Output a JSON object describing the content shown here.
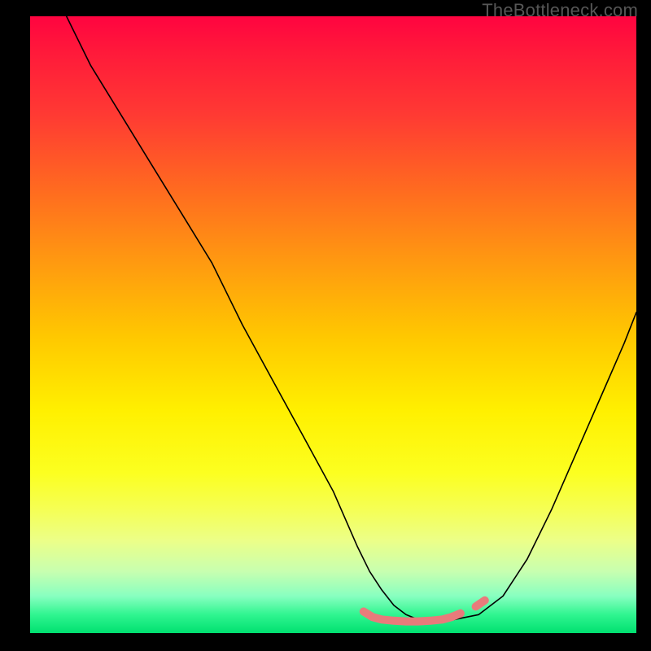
{
  "watermark": "TheBottleneck.com",
  "chart_data": {
    "type": "line",
    "title": "",
    "xlabel": "",
    "ylabel": "",
    "xlim": [
      0,
      100
    ],
    "ylim": [
      0,
      100
    ],
    "series": [
      {
        "name": "bottleneck-curve",
        "x_pct": [
          6,
          10,
          15,
          20,
          25,
          30,
          35,
          40,
          45,
          50,
          54,
          56,
          58,
          60,
          62,
          64,
          66,
          68,
          70,
          74,
          78,
          82,
          86,
          90,
          94,
          98,
          100
        ],
        "y_pct": [
          100,
          92,
          84,
          76,
          68,
          60,
          50,
          41,
          32,
          23,
          14,
          10,
          7,
          4.5,
          3,
          2.2,
          2,
          2,
          2.2,
          3,
          6,
          12,
          20,
          29,
          38,
          47,
          52
        ],
        "color": "#000000"
      },
      {
        "name": "zone-marker",
        "x_pct": [
          55,
          56.5,
          58,
          60,
          62,
          64,
          66,
          68,
          69.5,
          71
        ],
        "y_pct": [
          3.5,
          2.6,
          2.2,
          2.0,
          1.9,
          1.9,
          2.0,
          2.2,
          2.6,
          3.2
        ],
        "color": "#e87b7b"
      },
      {
        "name": "zone-marker-right",
        "x_pct": [
          73.5,
          75
        ],
        "y_pct": [
          4.3,
          5.3
        ],
        "color": "#e87b7b"
      }
    ],
    "gradient_stops": [
      {
        "pct": 0,
        "color": "#ff0440"
      },
      {
        "pct": 16,
        "color": "#ff3a33"
      },
      {
        "pct": 40,
        "color": "#ff9a10"
      },
      {
        "pct": 64,
        "color": "#fff000"
      },
      {
        "pct": 85,
        "color": "#ecff88"
      },
      {
        "pct": 97,
        "color": "#30f590"
      },
      {
        "pct": 100,
        "color": "#00e070"
      }
    ]
  }
}
